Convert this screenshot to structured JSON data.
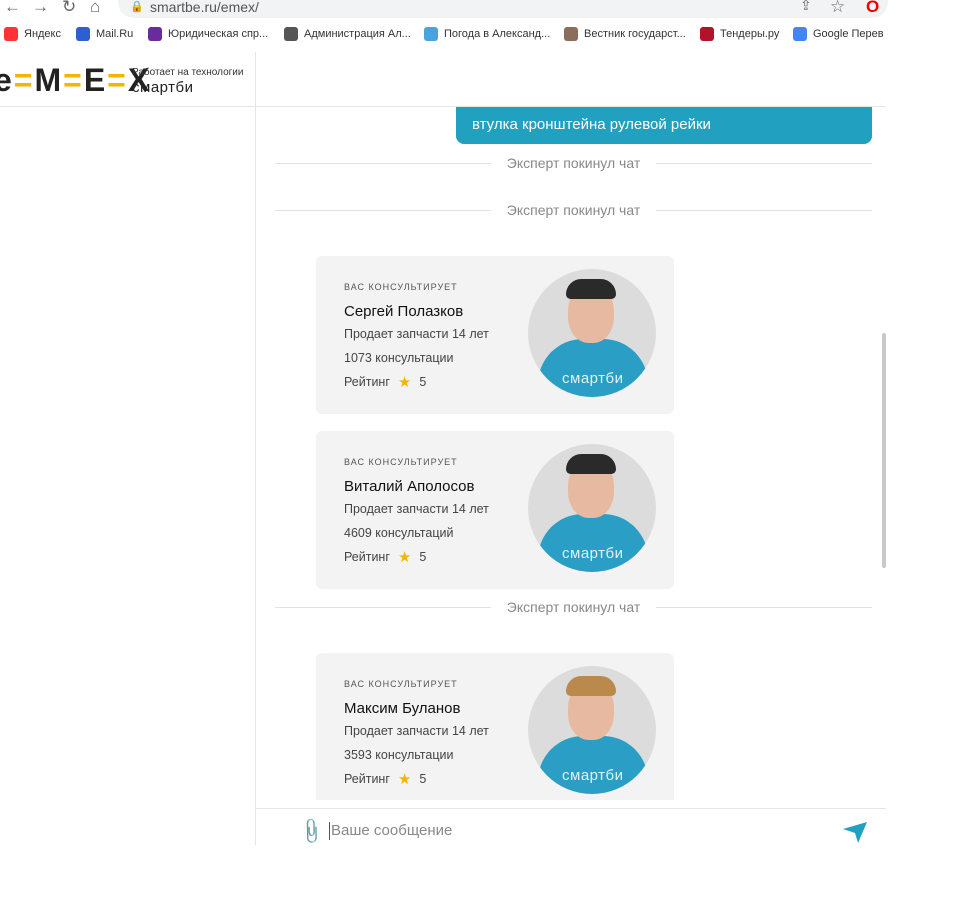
{
  "browser": {
    "url": "smartbe.ru/emex/",
    "bookmarks": [
      {
        "label": "Яндекс",
        "icon": "yandex-icon",
        "color": "#f33"
      },
      {
        "label": "Mail.Ru",
        "icon": "mailru-icon",
        "color": "#2d5fd3"
      },
      {
        "label": "Юридическая спр...",
        "icon": "legal-icon",
        "color": "#6a2c9c"
      },
      {
        "label": "Администрация Ал...",
        "icon": "globe-icon",
        "color": "#555"
      },
      {
        "label": "Погода в Александ...",
        "icon": "weather-icon",
        "color": "#4aa3df"
      },
      {
        "label": "Вестник государст...",
        "icon": "herald-icon",
        "color": "#8a6d5b"
      },
      {
        "label": "Тендеры.ру",
        "icon": "tenders-icon",
        "color": "#b3122b"
      },
      {
        "label": "Google Перев",
        "icon": "google-translate-icon",
        "color": "#4285f4"
      }
    ]
  },
  "header": {
    "logo": "emex",
    "tagline": "Работает на технологии",
    "brand": "смартби"
  },
  "chat": {
    "bubble_text": "втулка кронштейна рулевой рейки",
    "left_notices": [
      "Эксперт покинул чат",
      "Эксперт покинул чат",
      "Эксперт покинул чат"
    ],
    "experts": [
      {
        "label": "ВАС КОНСУЛЬТИРУЕТ",
        "name": "Сергей Полазков",
        "experience": "Продает запчасти 14 лет",
        "consultations": "1073 консультации",
        "rating_label": "Рейтинг",
        "rating": "5",
        "shirt_text": "смартби"
      },
      {
        "label": "ВАС КОНСУЛЬТИРУЕТ",
        "name": "Виталий Аполосов",
        "experience": "Продает запчасти 14 лет",
        "consultations": "4609 консультаций",
        "rating_label": "Рейтинг",
        "rating": "5",
        "shirt_text": "смартби"
      },
      {
        "label": "ВАС КОНСУЛЬТИРУЕТ",
        "name": "Максим Буланов",
        "experience": "Продает запчасти 14 лет",
        "consultations": "3593 консультации",
        "rating_label": "Рейтинг",
        "rating": "5",
        "shirt_text": "смартби"
      }
    ],
    "input_placeholder": "Ваше сообщение",
    "accent": "#22a0bf"
  }
}
